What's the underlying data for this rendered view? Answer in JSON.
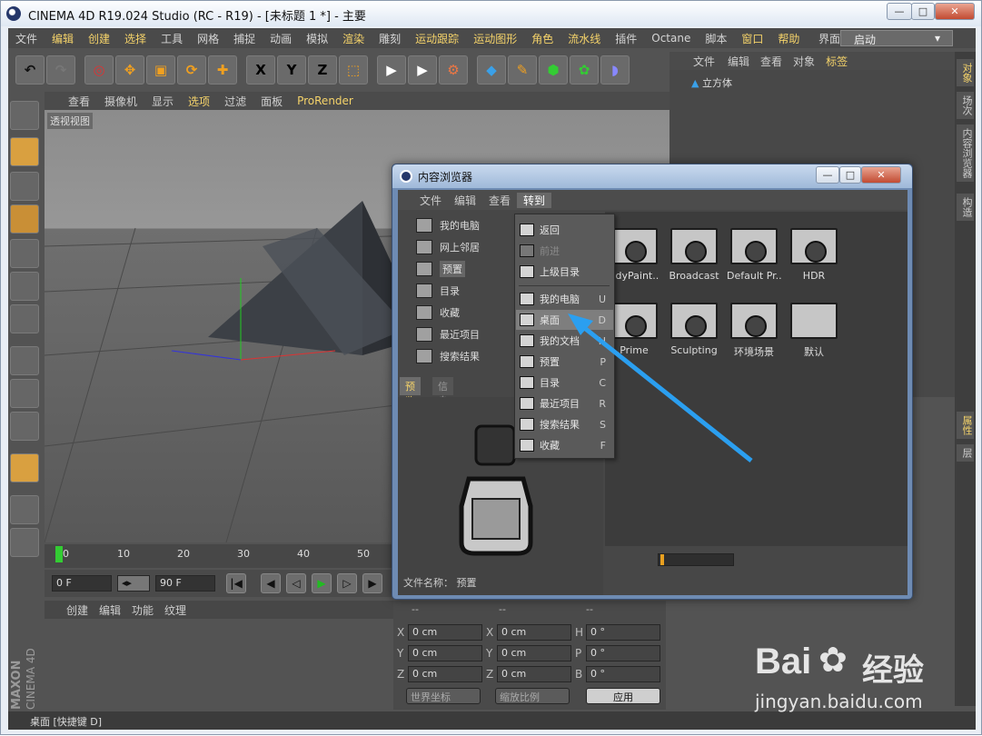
{
  "window": {
    "title": "CINEMA 4D R19.024 Studio (RC - R19) - [未标题 1 *] - 主要",
    "min": "—",
    "max": "□",
    "close": "✕"
  },
  "menu": [
    "文件",
    "编辑",
    "创建",
    "选择",
    "工具",
    "网格",
    "捕捉",
    "动画",
    "模拟",
    "渲染",
    "雕刻",
    "运动跟踪",
    "运动图形",
    "角色",
    "流水线",
    "插件",
    "Octane",
    "脚本",
    "窗口",
    "帮助"
  ],
  "layout": {
    "label": "界面:",
    "value": "启动"
  },
  "toolbar": {
    "undo_icon": "undo-icon",
    "x": "X",
    "y": "Y",
    "z": "Z"
  },
  "viewport_menu": [
    "查看",
    "摄像机",
    "显示",
    "选项",
    "过滤",
    "面板",
    "ProRender"
  ],
  "viewport": {
    "label": "透视视图"
  },
  "object_menu": [
    "文件",
    "编辑",
    "查看",
    "对象",
    "标签"
  ],
  "object": {
    "name": "立方体"
  },
  "side_tabs": [
    "对象",
    "场次",
    "内容浏览器",
    "构造",
    "属性",
    "层"
  ],
  "timeline": {
    "ticks": [
      "0",
      "10",
      "20",
      "30",
      "40",
      "50"
    ]
  },
  "playback": {
    "start": "0 F",
    "end": "90 F"
  },
  "material_menu": [
    "创建",
    "编辑",
    "功能",
    "纹理"
  ],
  "coords": {
    "x": "X",
    "y": "Y",
    "z": "Z",
    "h": "H",
    "p": "P",
    "b": "B",
    "xv": "0 cm",
    "yv": "0 cm",
    "zv": "0 cm",
    "sx": "0 cm",
    "sy": "0 cm",
    "sz": "0 cm",
    "hv": "0 °",
    "pv": "0 °",
    "bv": "0 °",
    "world": "世界坐标",
    "scale": "缩放比例",
    "apply": "应用",
    "dash": "--"
  },
  "status": "桌面 [快捷键 D]",
  "maxon": "MAXON",
  "c4d": "CINEMA 4D",
  "browser": {
    "title": "内容浏览器",
    "menu": [
      "文件",
      "编辑",
      "查看",
      "转到"
    ],
    "tree": [
      "我的电脑",
      "网上邻居",
      "预置",
      "目录",
      "收藏",
      "最近项目",
      "搜索结果"
    ],
    "tabs": [
      "预览",
      "信息"
    ],
    "filename_label": "文件名称：",
    "filename": "预置",
    "folders": [
      "odyPaint..",
      "Broadcast",
      "Default Pr..",
      "HDR",
      "Prime",
      "Sculpting",
      "环境场景",
      "默认"
    ]
  },
  "dropdown": [
    {
      "label": "返回",
      "key": ""
    },
    {
      "label": "前进",
      "key": ""
    },
    {
      "label": "上级目录",
      "key": ""
    },
    {
      "label": "我的电脑",
      "key": "U"
    },
    {
      "label": "桌面",
      "key": "D"
    },
    {
      "label": "我的文档",
      "key": "H"
    },
    {
      "label": "预置",
      "key": "P"
    },
    {
      "label": "目录",
      "key": "C"
    },
    {
      "label": "最近项目",
      "key": "R"
    },
    {
      "label": "搜索结果",
      "key": "S"
    },
    {
      "label": "收藏",
      "key": "F"
    }
  ],
  "watermark": {
    "brand": "Bai",
    "brand2": "经验",
    "url": "jingyan.baidu.com"
  },
  "colors": {
    "accent": "#f5d36a",
    "arrow": "#2b9ff0"
  }
}
